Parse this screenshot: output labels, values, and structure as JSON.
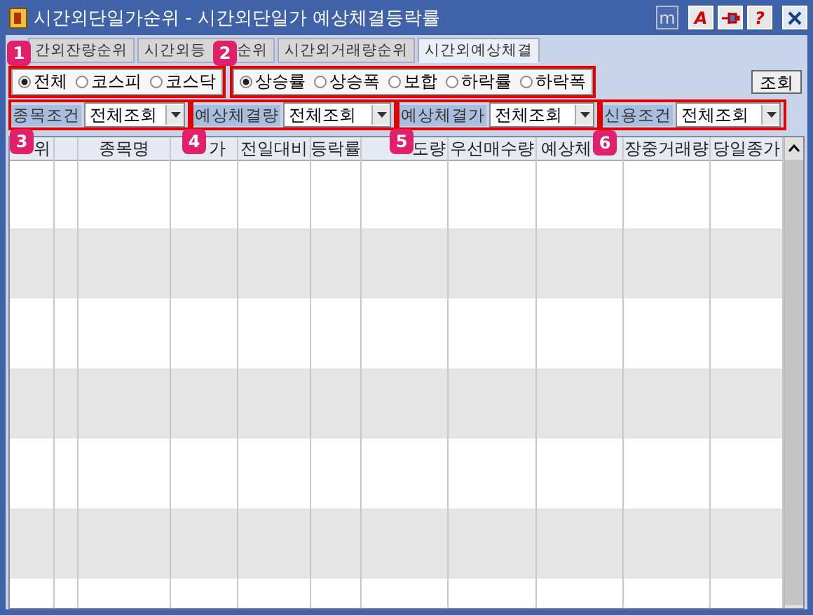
{
  "window": {
    "title": "시간외단일가순위 - 시간외단일가 예상체결등락률",
    "controls": [
      "m",
      "A",
      "?"
    ]
  },
  "tabs": [
    {
      "parts": [
        "간외잔량순위"
      ],
      "selected": false
    },
    {
      "parts": [
        "시간외등",
        "순위"
      ],
      "selected": false
    },
    {
      "parts": [
        "시간외거래량순위"
      ],
      "selected": false
    },
    {
      "parts": [
        "시간외예상체결"
      ],
      "selected": true
    }
  ],
  "market_options": [
    {
      "label": "전체",
      "selected": true
    },
    {
      "label": "코스피",
      "selected": false
    },
    {
      "label": "코스닥",
      "selected": false
    }
  ],
  "sort_options": [
    {
      "label": "상승률",
      "selected": true
    },
    {
      "label": "상승폭",
      "selected": false
    },
    {
      "label": "보합",
      "selected": false
    },
    {
      "label": "하락률",
      "selected": false
    },
    {
      "label": "하락폭",
      "selected": false
    }
  ],
  "search_button": "조회",
  "filters": [
    {
      "label": "종목조건",
      "value": "전체조회"
    },
    {
      "label": "예상체결량",
      "value": "전체조회"
    },
    {
      "label": "예상체결가",
      "value": "전체조회"
    },
    {
      "label": "신용조건",
      "value": "전체조회"
    }
  ],
  "table": {
    "columns": [
      "위",
      "",
      "종목명",
      "가",
      "전일대비",
      "등락률",
      "도량",
      "우선매수량",
      "예상체",
      "장중거래량",
      "당일종가"
    ]
  },
  "badges": [
    "1",
    "2",
    "3",
    "4",
    "5",
    "6"
  ]
}
